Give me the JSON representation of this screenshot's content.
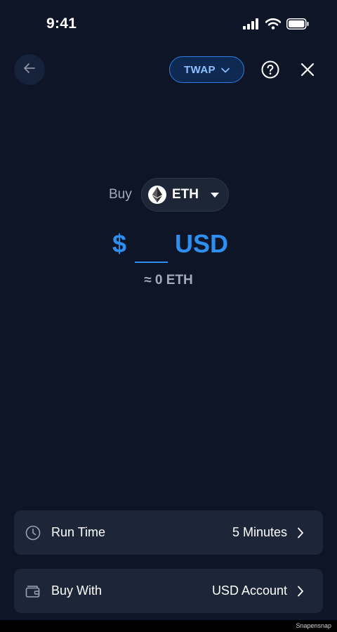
{
  "status_bar": {
    "time": "9:41"
  },
  "header": {
    "mode_label": "TWAP"
  },
  "buy": {
    "label": "Buy",
    "token": "ETH",
    "currency_sign": "$",
    "amount_value": "",
    "currency_code": "USD",
    "approx_text": "≈ 0 ETH"
  },
  "options": {
    "run_time": {
      "label": "Run Time",
      "value": "5 Minutes"
    },
    "buy_with": {
      "label": "Buy With",
      "value": "USD Account"
    }
  },
  "watermark": "Snapensnap",
  "colors": {
    "background": "#0d1527",
    "accent": "#2f8ff0",
    "card": "#1c2638"
  }
}
